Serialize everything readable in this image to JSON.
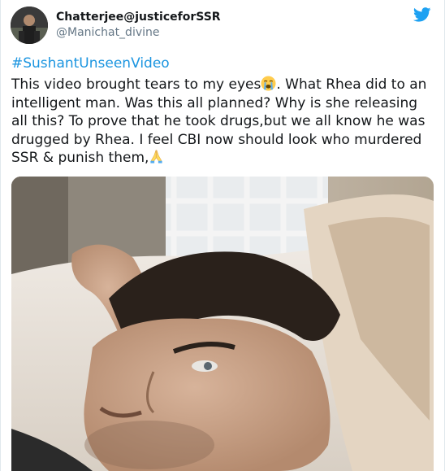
{
  "tweet": {
    "author": {
      "display_name": "Chatterjee@justiceforSSR",
      "handle": "@Manichat_divine"
    },
    "hashtag": "#SushantUnseenVideo",
    "body_part1": "This video brought tears to my eyes",
    "body_part2": ". What Rhea did to an intelligent man. Was this all planned? Why is she releasing all this? To prove that he took drugs,but we all know he was drugged by Rhea. I feel CBI now should look who murdered SSR & punish them,",
    "emoji_1": "crying-face",
    "emoji_2": "folded-hands"
  },
  "colors": {
    "hashtag": "#1b95e0",
    "twitter_blue": "#1da1f2",
    "handle_gray": "#657786",
    "text": "#14171a"
  },
  "icons": [
    "twitter-bird-icon",
    "avatar",
    "crying-face-emoji",
    "folded-hands-emoji"
  ]
}
